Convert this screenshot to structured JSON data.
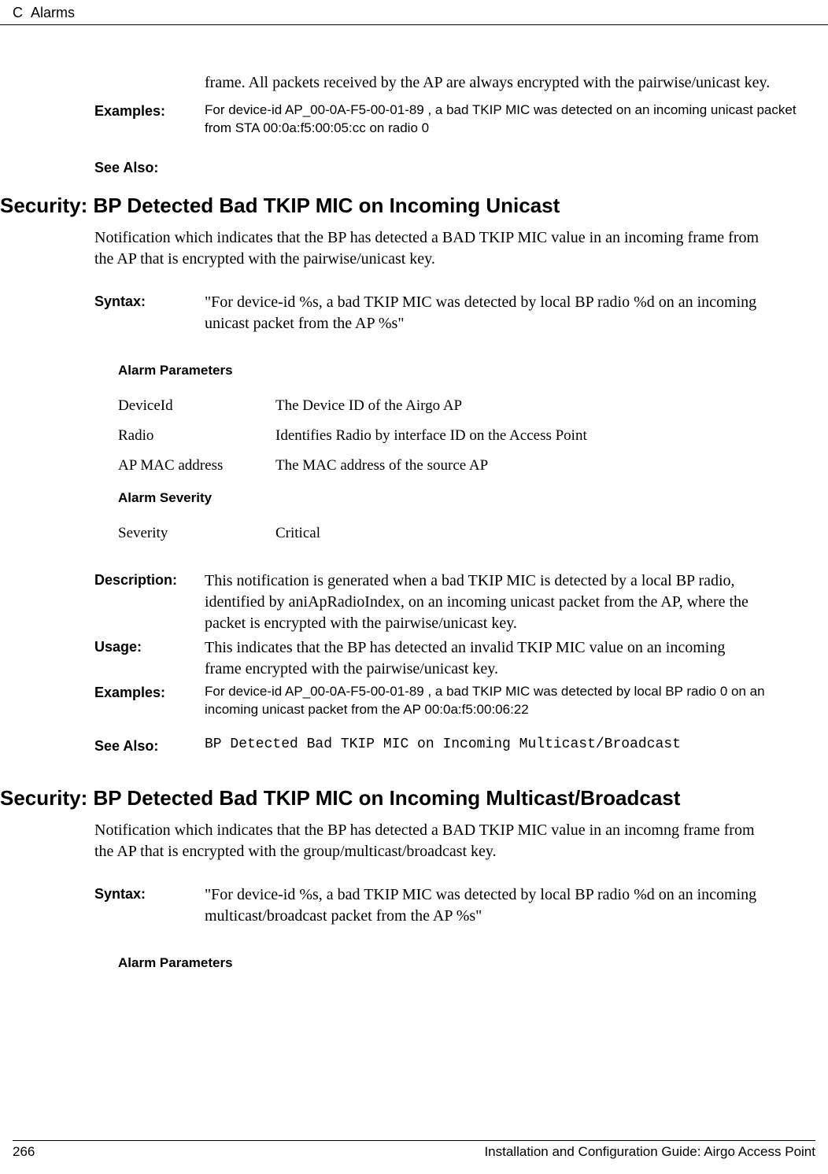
{
  "header": {
    "chapter": "C",
    "title": "Alarms"
  },
  "frag": {
    "para": "frame. All packets received by the AP are always encrypted with the pairwise/unicast key.",
    "examples_label": "Examples:",
    "examples_text": "For device-id AP_00-0A-F5-00-01-89 , a bad TKIP MIC was detected on an incoming unicast packet from STA 00:0a:f5:00:05:cc on radio 0",
    "see_also_label": "See Also:"
  },
  "sec1": {
    "heading": "Security: BP Detected Bad TKIP MIC on Incoming Unicast",
    "intro": "Notification which indicates that the BP has detected a BAD TKIP MIC value in an incoming frame from the AP that is encrypted with the pairwise/unicast key.",
    "syntax_label": "Syntax:",
    "syntax_text": "\"For device-id %s, a bad TKIP MIC was detected by local BP radio %d on an incoming unicast packet from the AP %s\"",
    "params_heading": "Alarm Parameters",
    "params": [
      {
        "name": "DeviceId",
        "desc": "The Device ID of the Airgo AP"
      },
      {
        "name": "Radio",
        "desc": "Identifies Radio by interface ID on the Access Point"
      },
      {
        "name": "AP MAC address",
        "desc": "The MAC address of the source AP"
      }
    ],
    "severity_heading": "Alarm Severity",
    "severity_name": "Severity",
    "severity_value": "Critical",
    "description_label": "Description:",
    "description_text": "This notification is generated when a bad TKIP MIC is detected by a local BP radio, identified by aniApRadioIndex, on an incoming unicast packet from the AP, where the packet is encrypted with the pairwise/unicast key.",
    "usage_label": "Usage:",
    "usage_text": "This indicates that the BP has detected an invalid TKIP MIC value on an incoming frame encrypted with the pairwise/unicast key.",
    "examples_label": "Examples:",
    "examples_text": "For device-id AP_00-0A-F5-00-01-89 , a bad TKIP MIC was detected by local BP radio 0 on an incoming unicast packet from the AP 00:0a:f5:00:06:22",
    "see_also_label": "See Also:",
    "see_also_text": "BP Detected Bad TKIP MIC on Incoming Multicast/Broadcast"
  },
  "sec2": {
    "heading": "Security: BP Detected Bad TKIP MIC on Incoming Multicast/Broadcast",
    "intro": "Notification which indicates that the BP has detected a BAD TKIP MIC value in an incomng frame from the AP that is encrypted with the group/multicast/broadcast key.",
    "syntax_label": "Syntax:",
    "syntax_text": "\"For device-id %s, a bad TKIP MIC was detected by local BP radio %d on an incoming multicast/broadcast packet from the AP %s\"",
    "params_heading": "Alarm Parameters"
  },
  "footer": {
    "page": "266",
    "guide": "Installation and Configuration Guide: Airgo Access Point"
  }
}
